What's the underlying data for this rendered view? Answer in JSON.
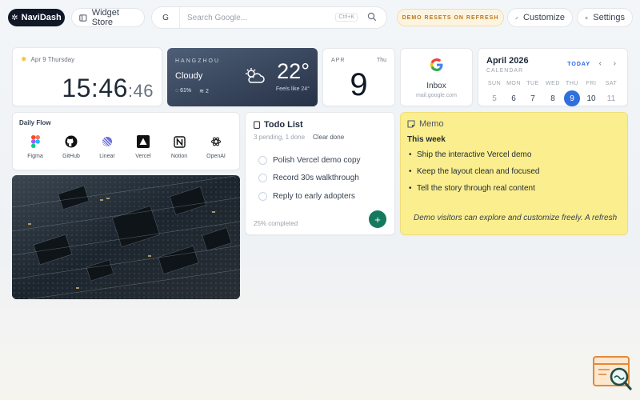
{
  "topbar": {
    "brand": "NaviDash",
    "widget_store": "Widget Store",
    "search_engine": "G",
    "search_placeholder": "Search Google...",
    "shortcut": "Ctrl+K",
    "reset_notice": "DEMO RESETS ON REFRESH",
    "customize": "Customize",
    "settings": "Settings"
  },
  "clock": {
    "date": "Apr 9 Thursday",
    "time": "15:46",
    "seconds": ":46"
  },
  "weather": {
    "city": "HANGZHOU",
    "condition": "Cloudy",
    "humidity": "61%",
    "wind": "2",
    "temperature": "22°",
    "feels_like": "Feels like 24°"
  },
  "day_card": {
    "month": "APR",
    "weekday": "Thu",
    "day": "9"
  },
  "mail": {
    "logo": "G",
    "title": "Inbox",
    "subtitle": "mail.google.com"
  },
  "calendar": {
    "month": "April 2026",
    "label": "CALENDAR",
    "today_button": "TODAY",
    "weekdays": [
      "SUN",
      "MON",
      "TUE",
      "WED",
      "THU",
      "FRI",
      "SAT"
    ],
    "days": [
      "5",
      "6",
      "7",
      "8",
      "9",
      "10",
      "11"
    ],
    "selected_index": 4,
    "accent_color": "#2f6fde"
  },
  "daily_flow": {
    "title": "Daily Flow",
    "apps": [
      {
        "name": "Figma",
        "icon": "figma-icon"
      },
      {
        "name": "GitHub",
        "icon": "github-icon"
      },
      {
        "name": "Linear",
        "icon": "linear-icon"
      },
      {
        "name": "Vercel",
        "icon": "vercel-icon"
      },
      {
        "name": "Notion",
        "icon": "notion-icon"
      },
      {
        "name": "OpenAI",
        "icon": "openai-icon"
      }
    ]
  },
  "todo": {
    "title": "Todo List",
    "meta": "3 pending, 1 done",
    "clear": "Clear done",
    "items": [
      "Polish Vercel demo copy",
      "Record 30s walkthrough",
      "Reply to early adopters"
    ],
    "progress": "25% completed",
    "accent_color": "#15795f"
  },
  "memo": {
    "title": "Memo",
    "heading": "This week",
    "bullets": [
      "Ship the interactive Vercel demo",
      "Keep the layout clean and focused",
      "Tell the story through real content"
    ],
    "note": "Demo visitors can explore and customize freely. A refresh",
    "background_color": "#fbee8e"
  }
}
